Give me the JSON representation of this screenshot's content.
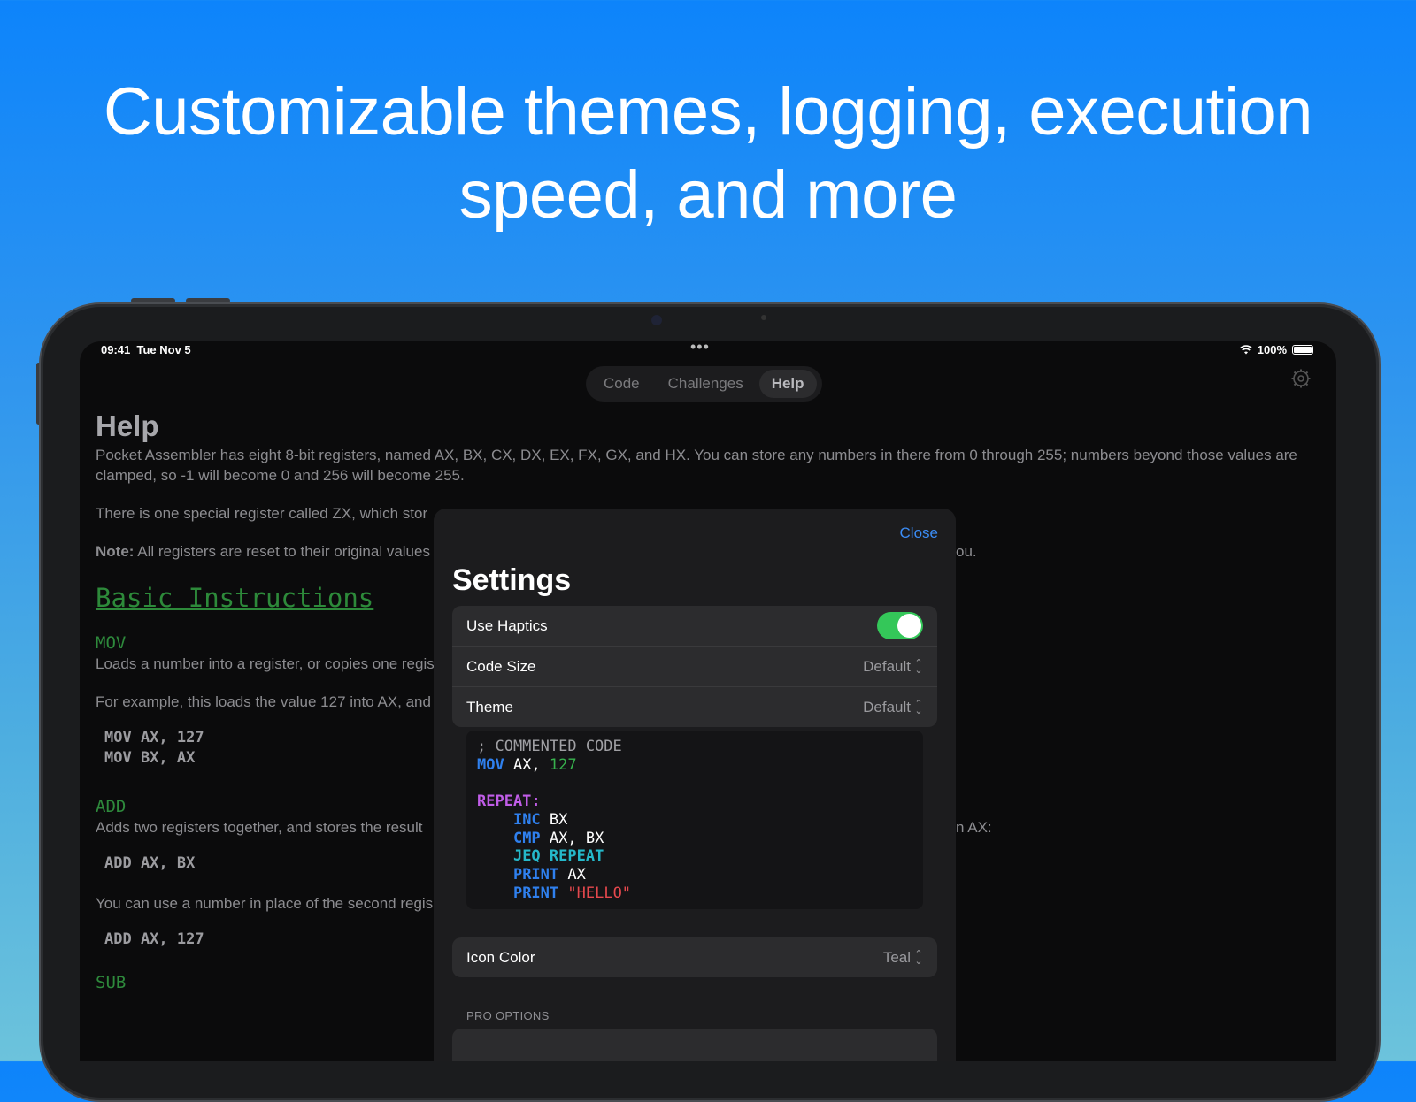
{
  "headline": {
    "line1": "Customizable themes, logging, execution",
    "line2": "speed, and more"
  },
  "status_bar": {
    "time": "09:41",
    "date": "Tue Nov 5",
    "battery": "100%"
  },
  "tabs": [
    {
      "label": "Code",
      "active": false
    },
    {
      "label": "Challenges",
      "active": false
    },
    {
      "label": "Help",
      "active": true
    }
  ],
  "help": {
    "title": "Help",
    "intro": "Pocket Assembler has eight 8-bit registers, named AX, BX, CX, DX, EX, FX, GX, and HX. You can store any numbers in there from 0 through 255; numbers beyond those values are clamped, so -1 will become 0 and 256 will become 255.",
    "zx_text": "There is one special register called ZX, which stor",
    "note_label": "Note:",
    "note_text": "All registers are reset to their original values",
    "note_tail": "ou.",
    "section_title": "Basic Instructions",
    "mov_title": "MOV",
    "mov_desc": "Loads a number into a register, or copies one regis",
    "mov_example": "For example, this loads the value 127 into AX, and",
    "mov_code": "MOV AX, 127\nMOV BX, AX",
    "add_title": "ADD",
    "add_desc": "Adds two registers together, and stores the result",
    "add_tail": "n AX:",
    "add_code": "ADD AX, BX",
    "add_number_text": "You can use a number in place of the second regis",
    "add_code2": "ADD AX, 127",
    "sub_title": "SUB"
  },
  "settings": {
    "close_label": "Close",
    "title": "Settings",
    "use_haptics_label": "Use Haptics",
    "use_haptics_on": true,
    "code_size_label": "Code Size",
    "code_size_value": "Default",
    "theme_label": "Theme",
    "theme_value": "Default",
    "icon_color_label": "Icon Color",
    "icon_color_value": "Teal",
    "pro_options_label": "PRO OPTIONS",
    "preview": {
      "comment": "; COMMENTED CODE",
      "mov_kw": "MOV",
      "mov_args": " AX, ",
      "mov_num": "127",
      "label": "REPEAT:",
      "inc_kw": "INC",
      "inc_args": " BX",
      "cmp_kw": "CMP",
      "cmp_args": " AX, BX",
      "jeq_kw": "JEQ",
      "jeq_target": "REPEAT",
      "print1_kw": "PRINT",
      "print1_args": " AX",
      "print2_kw": "PRINT",
      "print2_str": "\"HELLO\""
    }
  },
  "colors": {
    "toggle_on": "#34c759",
    "link": "#3b8cf5",
    "keyword": "#2f80ee",
    "number": "#37b24d",
    "label": "#c15de8",
    "string": "#e5484d",
    "section": "#2d8a3a"
  }
}
